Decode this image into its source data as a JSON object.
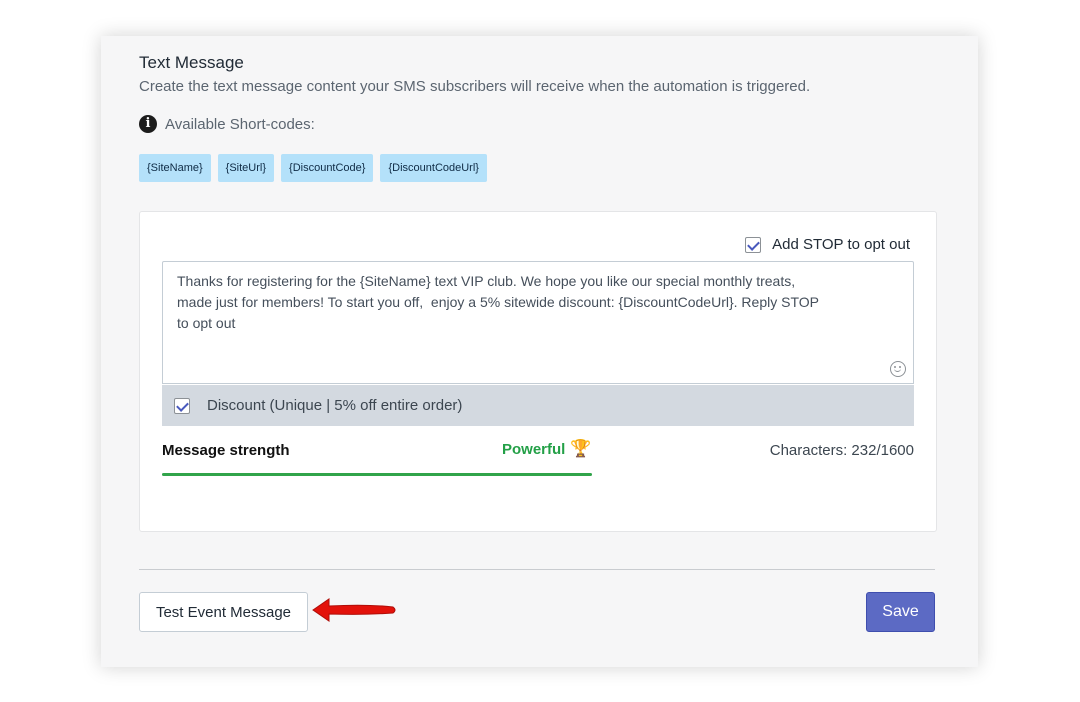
{
  "section": {
    "title": "Text Message",
    "subtitle": "Create the text message content your SMS subscribers will receive when the automation is triggered."
  },
  "shortcodes": {
    "icon": "info-icon",
    "label": "Available Short-codes:",
    "items": [
      "{SiteName}",
      "{SiteUrl}",
      "{DiscountCode}",
      "{DiscountCodeUrl}"
    ]
  },
  "editor": {
    "stop_label": "Add STOP to opt out",
    "stop_checked": true,
    "message": "Thanks for registering for the {SiteName} text VIP club. We hope you like our special monthly treats,\nmade just for members! To start you off,  enjoy a 5% sitewide discount: {DiscountCodeUrl}. Reply STOP\nto opt out",
    "emoji_icon": "emoji-icon",
    "discount_label": "Discount (Unique | 5% off entire order)",
    "discount_checked": true
  },
  "strength": {
    "label": "Message strength",
    "value": "Powerful",
    "icon": "trophy-icon",
    "level_percent": 100,
    "characters": "Characters: 232/1600",
    "color": "#31a44a"
  },
  "actions": {
    "test_label": "Test Event Message",
    "save_label": "Save",
    "save_color": "#5c6ac4",
    "arrow_color": "#e3120b"
  }
}
